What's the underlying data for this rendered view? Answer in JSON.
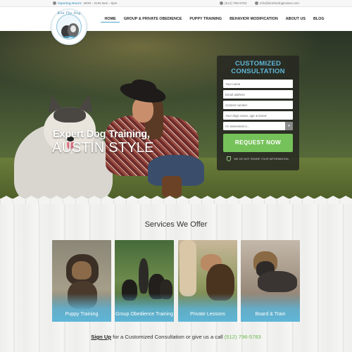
{
  "topbar": {
    "hours_label": "Opening Hours:",
    "hours_value": "MON - SUN 8am - 8pm",
    "phone": "(512) 796-5783",
    "email": "info@kimthedogtrainer.com"
  },
  "logo": {
    "text": "Kim The Dog Trainer"
  },
  "nav": {
    "items": [
      {
        "label": "HOME"
      },
      {
        "label": "GROUP & PRIVATE OBEDIENCE"
      },
      {
        "label": "PUPPY TRAINING"
      },
      {
        "label": "BEHAVIOR MODIFICATION"
      },
      {
        "label": "ABOUT US"
      },
      {
        "label": "BLOG"
      }
    ]
  },
  "hero": {
    "title": "Expert Dog Training,",
    "subtitle": "AUSTIN STYLE"
  },
  "form": {
    "title_line1": "CUSTOMIZED",
    "title_line2": "CONSULTATION",
    "name_placeholder": "Your name",
    "email_placeholder": "Email address",
    "phone_placeholder": "Contact number",
    "dog_placeholder": "Your dogs name, age & breed",
    "interest_placeholder": "I'm interested in...",
    "submit_label": "REQUEST NOW",
    "privacy_note": "WE DO NOT SHARE YOUR INFORMATION."
  },
  "services": {
    "title": "Services We Offer",
    "cards": [
      {
        "label": "Puppy Training"
      },
      {
        "label": "Group Obedience Training"
      },
      {
        "label": "Private Lessons"
      },
      {
        "label": "Board & Train"
      }
    ]
  },
  "cta": {
    "signup": "Sign Up",
    "middle": " for a Customized Consultation or give us a call ",
    "phone": "(512) 796-5783"
  },
  "colors": {
    "accent_blue": "#5fb6d8",
    "accent_green": "#76c25a"
  }
}
